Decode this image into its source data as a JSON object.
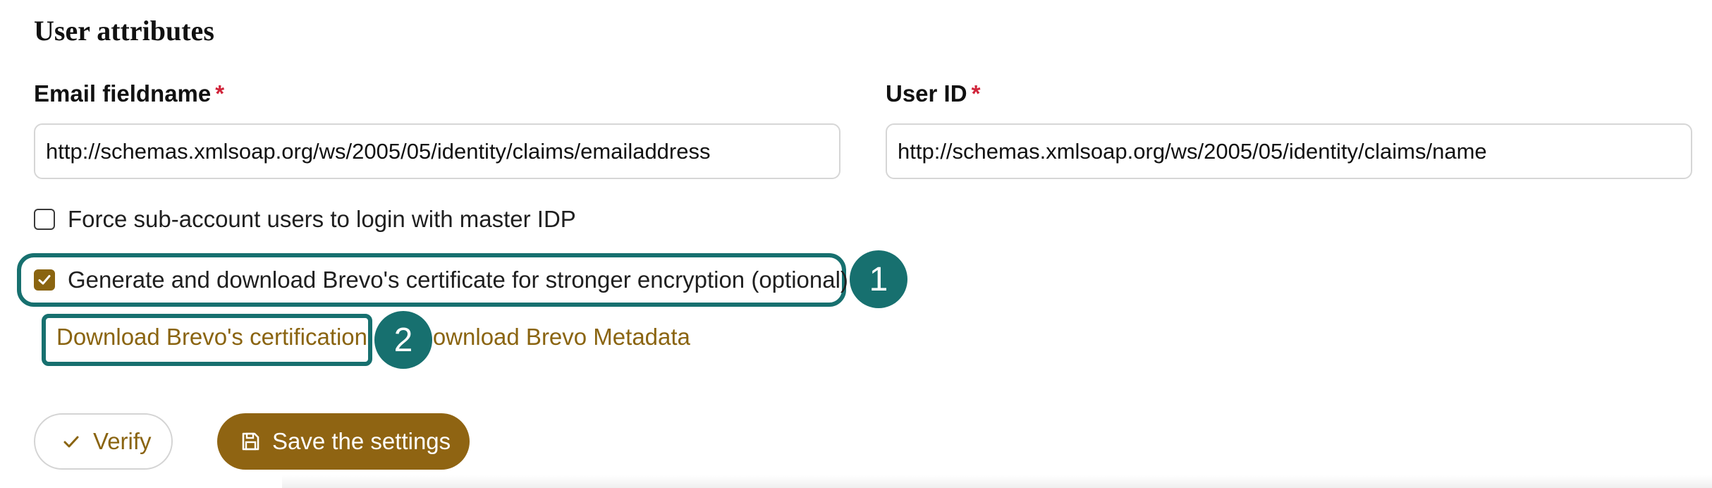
{
  "section": {
    "title": "User attributes"
  },
  "fields": {
    "email": {
      "label": "Email fieldname",
      "required_mark": "*",
      "value": "http://schemas.xmlsoap.org/ws/2005/05/identity/claims/emailaddress"
    },
    "user_id": {
      "label": "User ID",
      "required_mark": "*",
      "value": "http://schemas.xmlsoap.org/ws/2005/05/identity/claims/name"
    }
  },
  "options": {
    "force_master_idp": {
      "label": "Force sub-account users to login with master IDP",
      "checked": false
    },
    "generate_certificate": {
      "label": "Generate and download Brevo's certificate for stronger encryption (optional)",
      "checked": true
    }
  },
  "links": {
    "download_certification": "Download Brevo's certification",
    "download_metadata": "Download Brevo Metadata"
  },
  "annotations": {
    "step_1": "1",
    "step_2": "2"
  },
  "buttons": {
    "verify": "Verify",
    "save": "Save the settings"
  },
  "colors": {
    "accent": "#8a6410",
    "annotation": "#17706f",
    "required": "#d0243a"
  },
  "icons": {
    "verify": "check-icon",
    "save": "floppy-disk-icon",
    "checkbox_checked": "checkmark-icon"
  }
}
